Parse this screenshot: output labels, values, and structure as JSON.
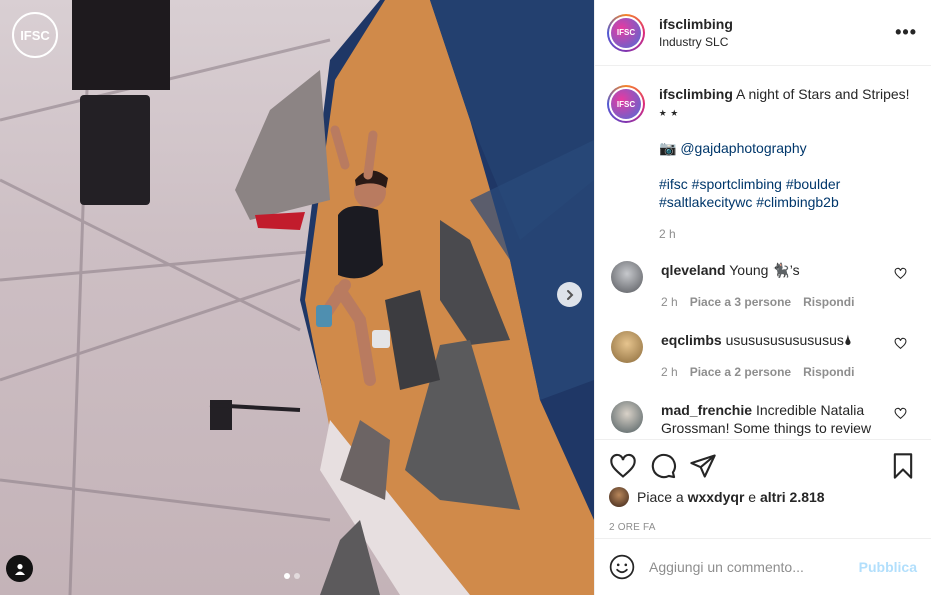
{
  "photo": {
    "logo_text": "IFSC",
    "next_icon": "chevron-right-icon",
    "tag_icon": "user-icon",
    "slides_total": 2,
    "slide_current": 1
  },
  "post": {
    "username": "ifsclimbing",
    "location": "Industry SLC",
    "more_icon": "more-horizontal-icon",
    "more_label": "•••",
    "avatar_text": "IFSC"
  },
  "caption": {
    "username": "ifsclimbing",
    "text": "A night of Stars and Stripes! ⭑ ⭑",
    "credit": "📷 @gajdaphotography",
    "hashtags": "#ifsc #sportclimbing #boulder #saltlakecitywc #climbingb2b",
    "time": "2 h"
  },
  "comments": [
    {
      "username": "qleveland",
      "text": "Young 🐈‍⬛’s",
      "time": "2 h",
      "likes": "Piace a 3 persone",
      "reply": "Rispondi",
      "avatar_color": "#8a8c90"
    },
    {
      "username": "eqclimbs",
      "text": "usususususususus🌢",
      "time": "2 h",
      "likes": "Piace a 2 persone",
      "reply": "Rispondi",
      "avatar_color": "#c9a36a"
    },
    {
      "username": "mad_frenchie",
      "text": "Incredible Natalia Grossman! Some things to review",
      "time": "",
      "likes": "",
      "reply": "",
      "avatar_color": "#6f7f86"
    }
  ],
  "actions": {
    "like_icon": "heart-icon",
    "comment_icon": "comment-icon",
    "share_icon": "paper-plane-icon",
    "save_icon": "bookmark-icon",
    "likes_prefix": "Piace a ",
    "likes_user": "wxxdyqr",
    "likes_mid": " e ",
    "likes_others": "altri 2.818",
    "posted_ago": "2 ORE FA"
  },
  "add_comment": {
    "emoji_icon": "smiley-icon",
    "placeholder": "Aggiungi un commento...",
    "publish_label": "Pubblica"
  },
  "colors": {
    "link": "#00376b",
    "muted": "#8e8e8e",
    "publish_disabled": "#b2dffc",
    "wall_orange": "#d08a4a",
    "wall_blue": "#1f3766"
  }
}
